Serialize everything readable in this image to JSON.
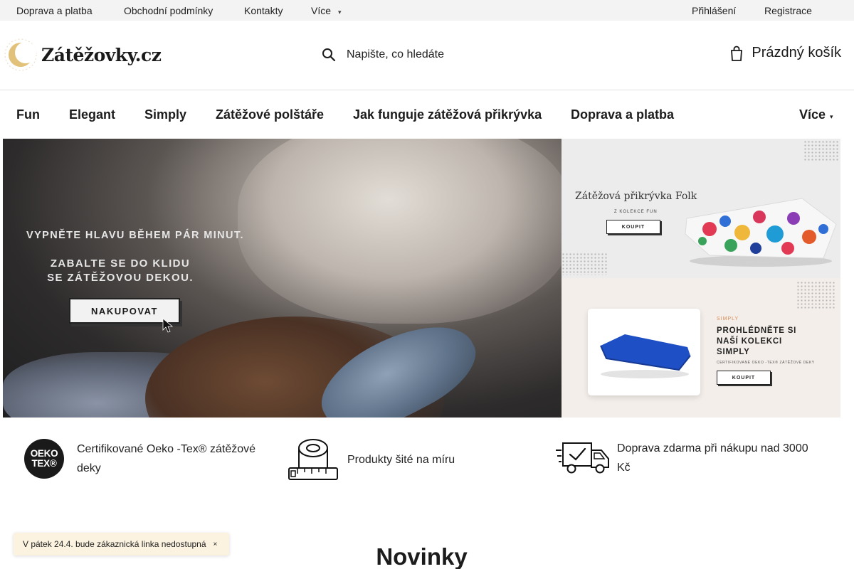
{
  "topbar": {
    "left_links": [
      "Doprava a platba",
      "Obchodní podmínky",
      "Kontakty",
      "Více"
    ],
    "more_chevron": "▾",
    "login": "Přihlášení",
    "register": "Registrace"
  },
  "header": {
    "logo_text": "Zátěžovky.cz",
    "search_placeholder": "Napište, co hledáte",
    "cart_label": "Prázdný košík"
  },
  "nav": {
    "items": [
      "Fun",
      "Elegant",
      "Simply",
      "Zátěžové polštáře",
      "Jak funguje zátěžová přikrývka",
      "Doprava a platba"
    ],
    "more": "Více",
    "more_chevron": "▾"
  },
  "hero": {
    "line1": "VYPNĚTE HLAVU BĚHEM PÁR MINUT.",
    "line2": "ZABALTE SE DO KLIDU SE ZÁTĚŽOVOU DEKOU.",
    "button": "NAKUPOVAT"
  },
  "banner_folk": {
    "title": "Zátěžová přikrývka Folk",
    "subtitle": "Z KOLEKCE FUN",
    "button": "KOUPIT"
  },
  "banner_simply": {
    "kicker": "SIMPLY",
    "headline": "PROHLÉDNĚTE SI NAŠÍ KOLEKCI SIMPLY",
    "cert": "CERTIFIKOVANÉ OEKO -TEX® ZÁTĚŽOVÉ DEKY",
    "button": "KOUPIT"
  },
  "features": {
    "oeko_line1": "OEKO",
    "oeko_line2": "TEX®",
    "f1": "Certifikované Oeko -Tex® zátěžové deky",
    "f2": "Produkty šité na míru",
    "f3": "Doprava zdarma při nákupu nad 3000 Kč"
  },
  "notice": {
    "text": "V pátek 24.4. bude zákaznická linka nedostupná",
    "close": "×"
  },
  "section": {
    "title": "Novinky"
  },
  "colors": {
    "accent": "#d98a53",
    "topbar_bg": "#f3f3f3",
    "notice_bg": "#fbf3df"
  }
}
